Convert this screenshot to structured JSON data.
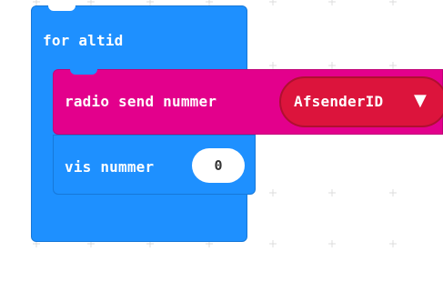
{
  "workspace": {
    "grid_color": "#dcdcdc",
    "background": "#ffffff"
  },
  "forever_block": {
    "label": "for altid",
    "color": "#1e90ff"
  },
  "radio_block": {
    "label": "radio send nummer",
    "color": "#e3008c",
    "dropdown": {
      "value": "AfsenderID",
      "color": "#dc143c",
      "icon": "dropdown-arrow-icon"
    }
  },
  "show_number_block": {
    "label": "vis nummer",
    "color": "#1e90ff",
    "value": "0"
  }
}
